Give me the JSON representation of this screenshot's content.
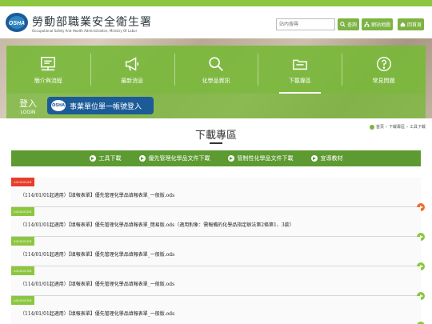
{
  "colors": {
    "brand_green": "#8cc63f",
    "menu_green": "#78b83a",
    "tab_green": "#5d9a32",
    "sso_blue": "#1c5b98",
    "date_red": "#e53e2a",
    "date_green": "#8cc63f",
    "arrow_orange": "#f26b2a",
    "arrow_green": "#8cc63f"
  },
  "header": {
    "logo_text": "OSHA",
    "title": "勞動部職業安全衛生署",
    "subtitle": "Occupational Safety And Health Administration, Ministry Of Labor",
    "search_placeholder": "站內搜尋",
    "buttons": [
      {
        "label": "查詢",
        "icon": "search-icon"
      },
      {
        "label": "網站地圖",
        "icon": "sitemap-icon"
      },
      {
        "label": "回首頁",
        "icon": "home-icon"
      }
    ]
  },
  "menu": [
    {
      "label": "簡介與流程",
      "icon": "board-icon"
    },
    {
      "label": "最新消息",
      "icon": "megaphone-icon"
    },
    {
      "label": "化學品資訊",
      "icon": "magnifier-icon"
    },
    {
      "label": "下載專區",
      "icon": "download-icon",
      "active": true
    },
    {
      "label": "常見問題",
      "icon": "question-icon"
    }
  ],
  "login": {
    "label": "登入",
    "label_en": "LOGIN",
    "sso_logo": "OSHA",
    "sso_button": "事業單位單一帳號登入"
  },
  "page": {
    "title": "下載專區",
    "breadcrumb": [
      "首頁",
      "下載專區",
      "工具下載"
    ]
  },
  "tabs": [
    {
      "label": "工具下載"
    },
    {
      "label": "優先管理化學品文件下載"
    },
    {
      "label": "管制性化學品文件下載"
    },
    {
      "label": "宣導教材"
    }
  ],
  "rows": [
    {
      "date": "2025/02/01",
      "text": "（114/01/01起適用）【填報表單】優先管理化學品填報表單_一般版.ods",
      "date_color": "#e53e2a",
      "arrow_color": "#f26b2a"
    },
    {
      "date": "2025/01/01",
      "text": "（114/01/01起適用）【填報表單】優先管理化學品填報表單_簡易版.ods（適用對象：需報備的化學品指定辦法第2條第1、3款）",
      "date_color": "#8cc63f",
      "arrow_color": "#8cc63f"
    },
    {
      "date": "2025/01/01",
      "text": "（114/01/01起適用）【填報表單】優先管理化學品填報表單_一般版.ods",
      "date_color": "#8cc63f",
      "arrow_color": "#8cc63f"
    },
    {
      "date": "2025/01/01",
      "text": "（114/01/01起適用）【填報表單】優先管理化學品填報表單_一般版.ods",
      "date_color": "#8cc63f",
      "arrow_color": "#8cc63f"
    },
    {
      "date": "2025/01/01",
      "text": "（114/01/01起適用）【填報表單】優先管理化學品填報表單_一般版.ods",
      "date_color": "#8cc63f",
      "arrow_color": "#8cc63f"
    }
  ]
}
